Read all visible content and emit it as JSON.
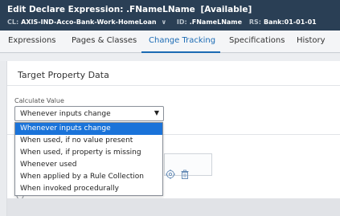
{
  "header": {
    "edit_label": "Edit",
    "title": "Declare Expression: .FNameLName",
    "status": "[Available]",
    "cl_label": "CL:",
    "cl_value": "AXIS-IND-Acco-Bank-Work-HomeLoan",
    "id_label": "ID:",
    "id_value": ".FNameLName",
    "rs_label": "RS:",
    "rs_value": "Bank:01-01-01"
  },
  "tabs": [
    {
      "label": "Expressions"
    },
    {
      "label": "Pages & Classes"
    },
    {
      "label": "Change Tracking"
    },
    {
      "label": "Specifications"
    },
    {
      "label": "History"
    }
  ],
  "active_tab": "Change Tracking",
  "section": {
    "title": "Target Property Data",
    "field_label": "Calculate Value",
    "selected_value": "Whenever inputs change"
  },
  "dropdown_options": [
    "Whenever inputs change",
    "When used, if no value present",
    "When used, if property is missing",
    "Whenever used",
    "When applied by a Rule Collection",
    "When invoked procedurally"
  ],
  "colors": {
    "header_bg": "#2a3f55",
    "accent": "#1b6bb4",
    "option_highlight": "#1a73d9"
  }
}
